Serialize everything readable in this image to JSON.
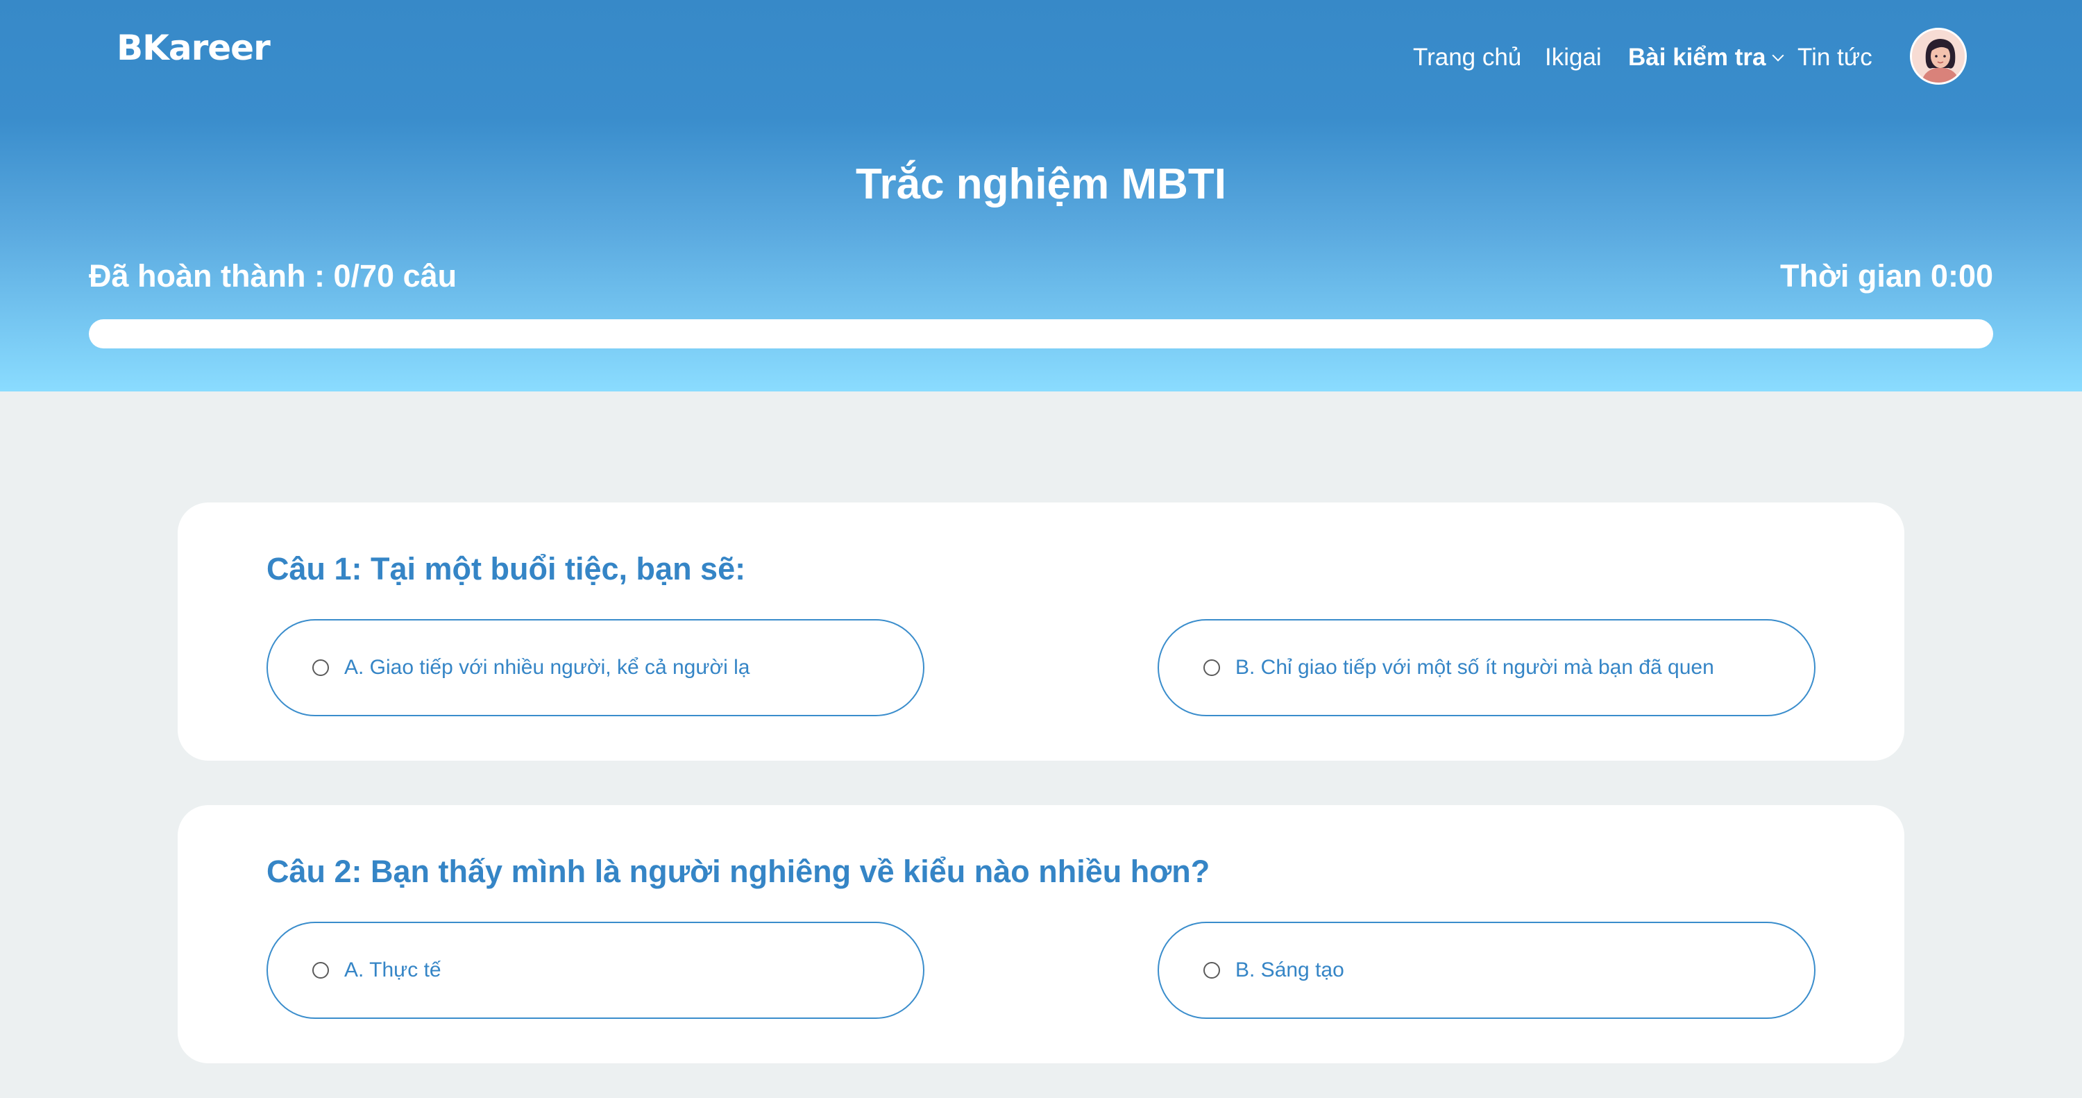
{
  "header": {
    "brand": "BKareer",
    "nav": [
      {
        "label": "Trang chủ"
      },
      {
        "label": "Ikigai"
      },
      {
        "label": "Bài kiểm tra"
      },
      {
        "label": "Tin tức"
      }
    ],
    "avatar_icon": "user-avatar-icon"
  },
  "quiz": {
    "title": "Trắc nghiệm MBTI",
    "progress_label": "Đã hoàn thành : 0/70 câu",
    "progress_fraction": 0,
    "timer_label": "Thời gian 0:00"
  },
  "questions": [
    {
      "title": "Câu 1: Tại một buổi tiệc, bạn sẽ:",
      "option_a": "A. Giao tiếp với nhiều người, kể cả người lạ",
      "option_b": "B. Chỉ giao tiếp với một số ít người mà bạn đã quen"
    },
    {
      "title": "Câu 2: Bạn thấy mình là người nghiêng về kiểu nào nhiều hơn?",
      "option_a": "A. Thực tế",
      "option_b": "B. Sáng tạo"
    }
  ],
  "colors": {
    "primary": "#3585c6",
    "hero_top": "#3789c8",
    "hero_bottom": "#8adcff",
    "page_bg": "#ecf0f1"
  }
}
